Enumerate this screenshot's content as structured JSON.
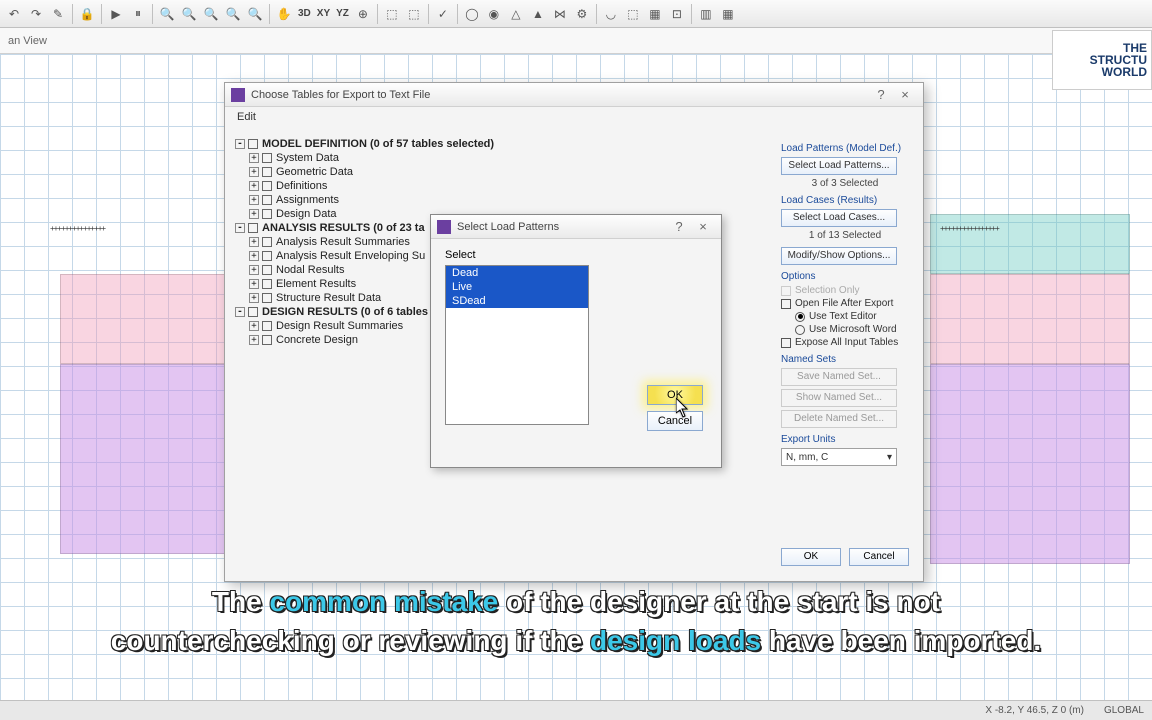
{
  "toolbar": {
    "labels": {
      "threeD": "3D",
      "xy": "XY",
      "yz": "YZ"
    }
  },
  "viewtab": "an View",
  "logo": {
    "l1": "THE",
    "l2": "STRUCTU",
    "l3": "WORLD"
  },
  "dialog1": {
    "title": "Choose Tables for Export to Text File",
    "help": "?",
    "close": "×",
    "menu_edit": "Edit",
    "tree": {
      "model_def": "MODEL DEFINITION  (0 of 57 tables selected)",
      "system_data": "System Data",
      "geometric_data": "Geometric Data",
      "definitions": "Definitions",
      "assignments": "Assignments",
      "design_data": "Design Data",
      "analysis_results": "ANALYSIS RESULTS  (0 of 23 ta",
      "ar_summaries": "Analysis Result Summaries",
      "ar_envelope": "Analysis Result Enveloping Su",
      "nodal": "Nodal Results",
      "element": "Element Results",
      "struct_result": "Structure Result Data",
      "design_results": "DESIGN RESULTS  (0 of 6 tables",
      "dr_summaries": "Design Result Summaries",
      "concrete": "Concrete Design"
    },
    "right": {
      "grp_loadpat": "Load Patterns (Model Def.)",
      "btn_selpat": "Select Load Patterns...",
      "stat_pat": "3 of 3 Selected",
      "grp_loadcase": "Load Cases (Results)",
      "btn_selcase": "Select Load Cases...",
      "stat_case": "1 of 13 Selected",
      "btn_modify": "Modify/Show Options...",
      "grp_options": "Options",
      "opt_selonly": "Selection Only",
      "opt_openafter": "Open File After Export",
      "opt_usetext": "Use Text Editor",
      "opt_useword": "Use Microsoft Word",
      "opt_expose": "Expose All Input Tables",
      "grp_named": "Named Sets",
      "btn_save": "Save Named Set...",
      "btn_show": "Show Named Set...",
      "btn_delete": "Delete Named Set...",
      "grp_units": "Export Units",
      "combo_units": "N, mm, C"
    },
    "footer": {
      "ok": "OK",
      "cancel": "Cancel"
    }
  },
  "dialog2": {
    "title": "Select Load Patterns",
    "help": "?",
    "close": "×",
    "select_label": "Select",
    "items": {
      "dead": "Dead",
      "live": "Live",
      "sdead": "SDead"
    },
    "ok": "OK",
    "cancel": "Cancel"
  },
  "status": {
    "coords": "X -8.2, Y 46.5, Z 0 (m)",
    "global": "GLOBAL"
  },
  "subtitle": {
    "p1": "The ",
    "p2": "common mistake",
    "p3": " of the designer at the start is not",
    "p4": "counterchecking or reviewing if the ",
    "p5": "design loads",
    "p6": " have been imported."
  }
}
